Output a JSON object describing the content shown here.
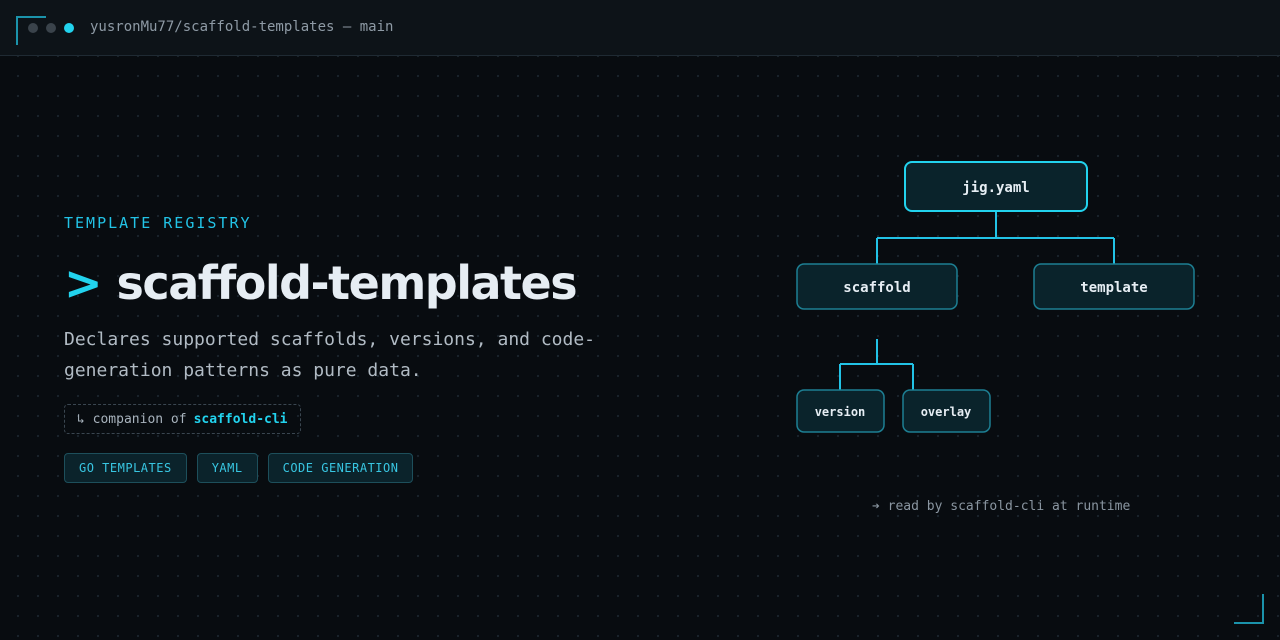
{
  "window": {
    "title": "yusronMu77/scaffold-templates — main"
  },
  "hero": {
    "eyebrow": "TEMPLATE REGISTRY",
    "caret": ">",
    "name": "scaffold-templates",
    "description": "Declares supported scaffolds, versions, and code-generation patterns as pure data.",
    "companion_prefix": "↳ companion of",
    "companion_link": "scaffold-cli"
  },
  "tags": [
    "GO TEMPLATES",
    "YAML",
    "CODE GENERATION"
  ],
  "diagram": {
    "root": "jig.yaml",
    "scaffold": "scaffold",
    "template": "template",
    "version": "version",
    "overlay": "overlay",
    "footnote": "➔ read by scaffold-cli at runtime"
  },
  "colors": {
    "accent": "#22d3ee",
    "background": "#080c10",
    "node_fill": "#0a232b"
  }
}
